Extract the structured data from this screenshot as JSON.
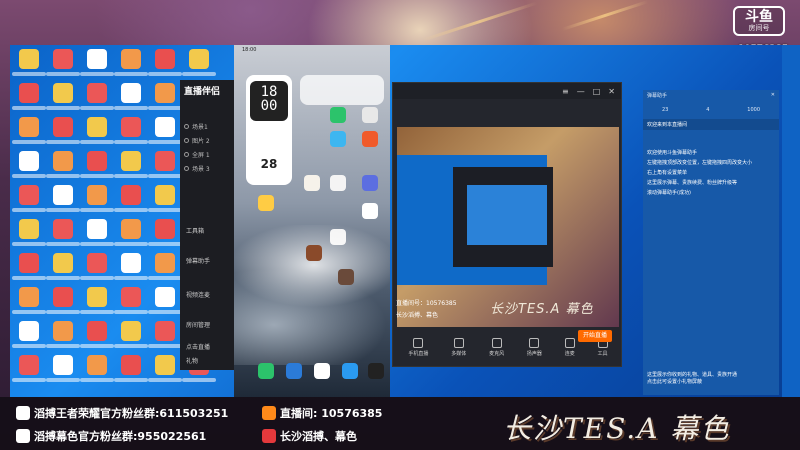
{
  "platform": {
    "logo_main": "斗鱼",
    "logo_sub": "房间号",
    "room_id": "10576385"
  },
  "streaming_app": {
    "brand": "直播伴侣",
    "scenes": [
      "场景1",
      "图片 2",
      "全屏 1",
      "场景 3"
    ],
    "tools": [
      "工具箱",
      "弹幕助手",
      "视频连麦",
      "房间管理",
      "点击直播",
      "礼物"
    ]
  },
  "phone": {
    "status_time": "18:00",
    "clock": "18\n00",
    "calendar_day": "28"
  },
  "obs": {
    "title_icons": [
      "≡",
      "—",
      "□",
      "✕"
    ],
    "caption": "长沙TES.A 幕色",
    "overlay_lines": [
      "直播间号：10576385",
      "长沙滔搏、幕色"
    ],
    "buttons": [
      "手机直播",
      "多媒体",
      "麦克风",
      "扬声器",
      "连麦",
      "工具"
    ],
    "start_label": "开始直播"
  },
  "chat": {
    "title": "弹幕助手",
    "stats": [
      "23",
      "4",
      "1000"
    ],
    "welcome": "欢迎来到本直播间",
    "messages": [
      "欢迎使用斗鱼弹幕助手",
      "左键拖拽顶部改变位置，左键拖拽四周改变大小",
      "右上角有设置菜单",
      "这里展示弹幕、贵族续费、粉丝牌升级等",
      "滚动弹幕助手(成功)"
    ],
    "footer": [
      "这里展示你收到的礼物、道具、贵族开通",
      "点击此可设置小礼物屏蔽"
    ]
  },
  "footer": {
    "line1_left": "滔搏王者荣耀官方粉丝群:611503251",
    "line1_right": "直播间: 10576385",
    "line2_left": "滔搏幕色官方粉丝群:955022561",
    "line2_right": "长沙滔搏、幕色",
    "big_caption": "长沙TES.A 幕色"
  },
  "colors": {
    "accent": "#ff6a00",
    "desktop_blue": "#0b63c8",
    "chat_blue": "#1759a8"
  }
}
